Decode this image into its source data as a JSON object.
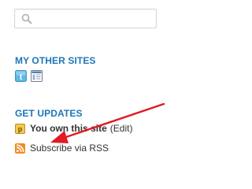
{
  "search": {
    "placeholder": "",
    "value": "",
    "icon": "search-icon"
  },
  "my_other_sites": {
    "heading": "MY OTHER SITES",
    "icons": [
      "twitter-icon",
      "blog-page-icon"
    ]
  },
  "get_updates": {
    "heading": "GET UPDATES",
    "own_site_text": "You own this site",
    "edit_label": "(Edit)",
    "rss_label": "Subscribe via RSS"
  },
  "colors": {
    "heading_blue": "#1d77b6",
    "text": "#333333",
    "annotation_red": "#e01b24",
    "rss_orange": "#f38a1e",
    "badge_yellow": "#f3c94a"
  }
}
